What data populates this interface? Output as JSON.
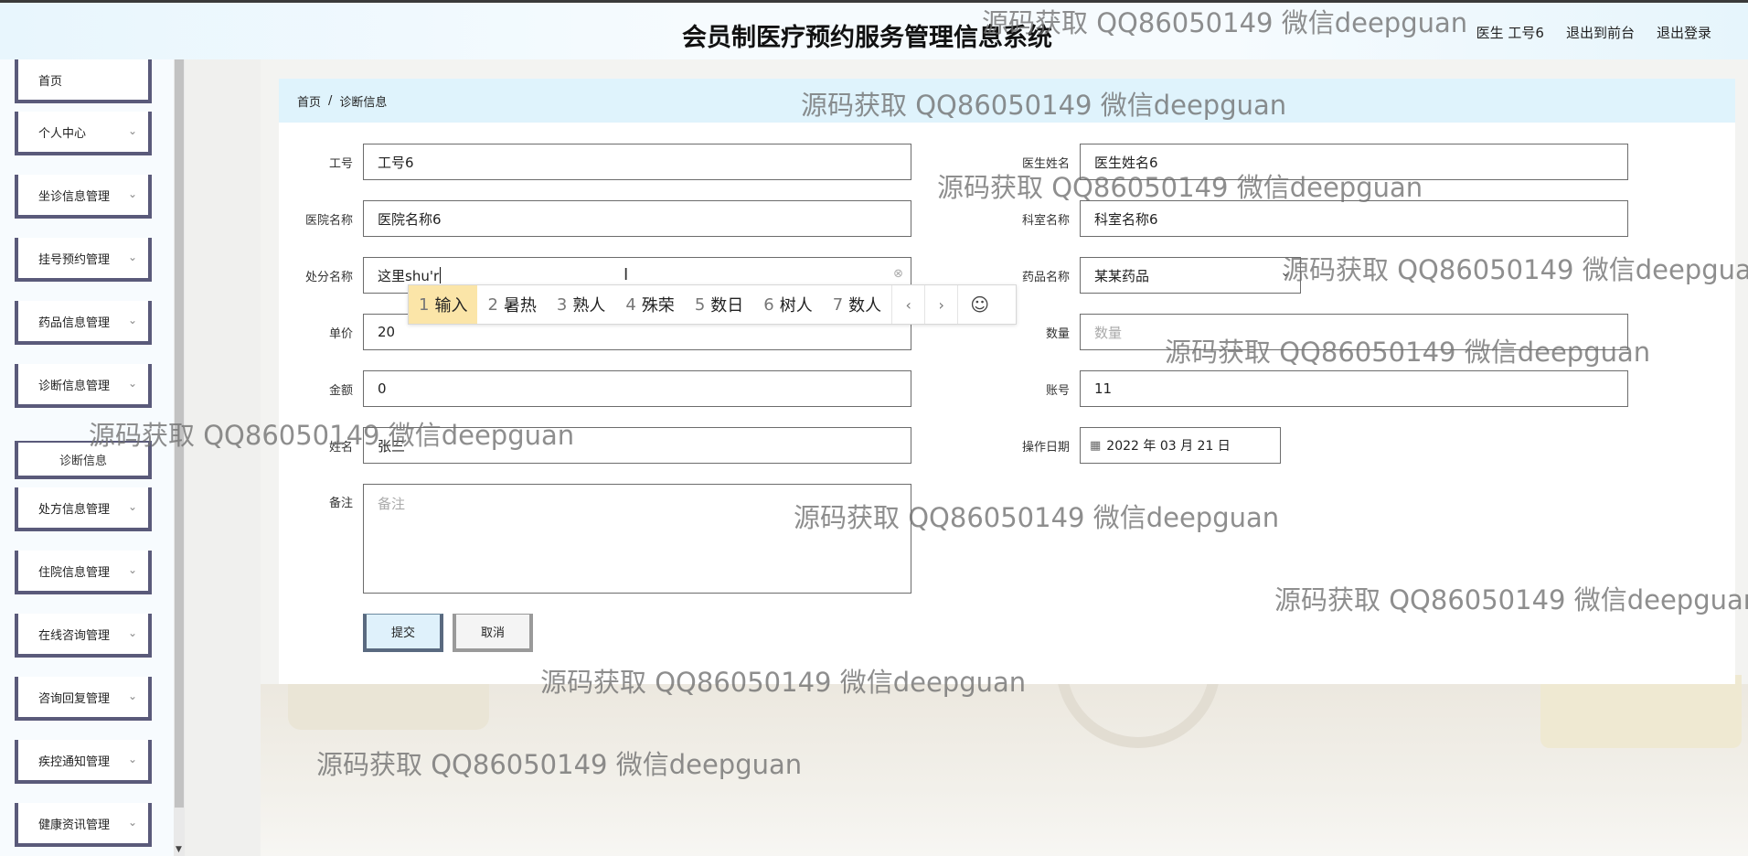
{
  "header": {
    "title": "会员制医疗预约服务管理信息系统",
    "user": "医生 工号6",
    "back_front": "退出到前台",
    "logout": "退出登录"
  },
  "sidebar": {
    "items": [
      {
        "label": "首页"
      },
      {
        "label": "个人中心"
      },
      {
        "label": "坐诊信息管理"
      },
      {
        "label": "挂号预约管理"
      },
      {
        "label": "药品信息管理"
      },
      {
        "label": "诊断信息管理"
      },
      {
        "label": "诊断信息"
      },
      {
        "label": "处方信息管理"
      },
      {
        "label": "住院信息管理"
      },
      {
        "label": "在线咨询管理"
      },
      {
        "label": "咨询回复管理"
      },
      {
        "label": "疾控通知管理"
      },
      {
        "label": "健康资讯管理"
      }
    ]
  },
  "breadcrumb": {
    "home": "首页",
    "sep": "/",
    "current": "诊断信息"
  },
  "form": {
    "gonghao": {
      "label": "工号",
      "value": "工号6"
    },
    "yishengxingming": {
      "label": "医生姓名",
      "value": "医生姓名6"
    },
    "yiyuanmingcheng": {
      "label": "医院名称",
      "value": "医院名称6"
    },
    "keshimingcheng": {
      "label": "科室名称",
      "value": "科室名称6"
    },
    "chufangmingcheng": {
      "label": "处分名称",
      "value": "这里shu'r"
    },
    "yaopinmingcheng": {
      "label": "药品名称",
      "value": "某某药品"
    },
    "danjia": {
      "label": "单价",
      "value": "20"
    },
    "shuliang": {
      "label": "数量",
      "placeholder": "数量"
    },
    "jine": {
      "label": "金额",
      "value": "0"
    },
    "zhanghao": {
      "label": "账号",
      "value": "11"
    },
    "xingming": {
      "label": "姓名",
      "value": "张三"
    },
    "caozuoriqi": {
      "label": "操作日期",
      "value": "2022 年 03 月 21 日"
    },
    "beizhu": {
      "label": "备注",
      "placeholder": "备注"
    }
  },
  "buttons": {
    "submit": "提交",
    "cancel": "取消"
  },
  "ime": {
    "candidates": [
      {
        "n": "1",
        "text": "输入"
      },
      {
        "n": "2",
        "text": "暑热"
      },
      {
        "n": "3",
        "text": "熟人"
      },
      {
        "n": "4",
        "text": "殊荣"
      },
      {
        "n": "5",
        "text": "数日"
      },
      {
        "n": "6",
        "text": "树人"
      },
      {
        "n": "7",
        "text": "数人"
      }
    ],
    "prev": "‹",
    "next": "›",
    "emoji": "☺"
  },
  "watermark": "源码获取 QQ86050149 微信deepguan",
  "colors": {
    "accent_bar": "#dff3fc",
    "menu_border": "#5a5a7a",
    "ime_selected": "#fbe5a8"
  }
}
